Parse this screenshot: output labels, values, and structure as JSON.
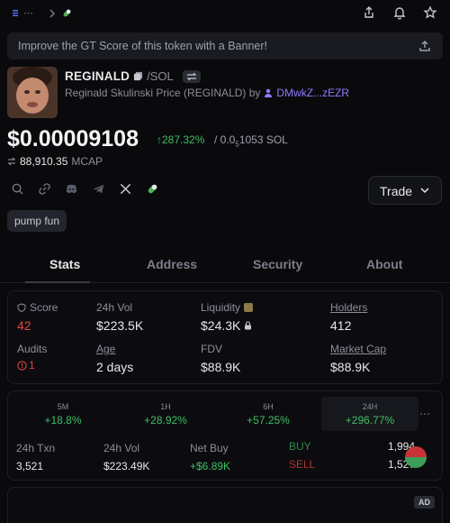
{
  "topbar": {
    "crumbs": "⋯"
  },
  "banner": {
    "text": "Improve the GT Score of this token with a Banner!"
  },
  "token": {
    "symbol": "REGINALD",
    "pair": "/SOL",
    "full_name": "Reginald Skulinski Price (REGINALD) by",
    "creator": "DMwkZ...zEZR"
  },
  "price": {
    "usd": "$0.00009108",
    "change": "287.32%",
    "sol_prefix": "/ 0.0",
    "sol_sub": "5",
    "sol_rest": "1053 SOL",
    "mcap_value": "88,910.35",
    "mcap_label": "MCAP"
  },
  "trade": {
    "label": "Trade"
  },
  "tag": "pump fun",
  "tabs": [
    "Stats",
    "Address",
    "Security",
    "About"
  ],
  "stats": {
    "score_label": "Score",
    "score_value": "42",
    "vol_label": "24h Vol",
    "vol_value": "$223.5K",
    "liq_label": "Liquidity",
    "liq_value": "$24.3K",
    "holders_label": "Holders",
    "holders_value": "412",
    "audits_label": "Audits",
    "audits_value": "1",
    "age_label": "Age",
    "age_value": "2 days",
    "fdv_label": "FDV",
    "fdv_value": "$88.9K",
    "mcap_label": "Market Cap",
    "mcap_value": "$88.9K"
  },
  "timeframes": [
    {
      "k": "5M",
      "p": "+18.8%"
    },
    {
      "k": "1H",
      "p": "+28.92%"
    },
    {
      "k": "6H",
      "p": "+57.25%"
    },
    {
      "k": "24H",
      "p": "+296.77%"
    }
  ],
  "more": "⋯",
  "tx": {
    "txn_label": "24h Txn",
    "txn_value": "3,521",
    "vol_label": "24h Vol",
    "vol_value": "$223.49K",
    "net_label": "Net Buy",
    "net_value": "+$6.89K",
    "buy_label": "BUY",
    "buy_value": "1,994",
    "sell_label": "SELL",
    "sell_value": "1,527"
  },
  "ad": {
    "label": "AD"
  },
  "colors": {
    "green": "#3fbf62",
    "red": "#e0453d",
    "accent": "#8f7cff"
  }
}
